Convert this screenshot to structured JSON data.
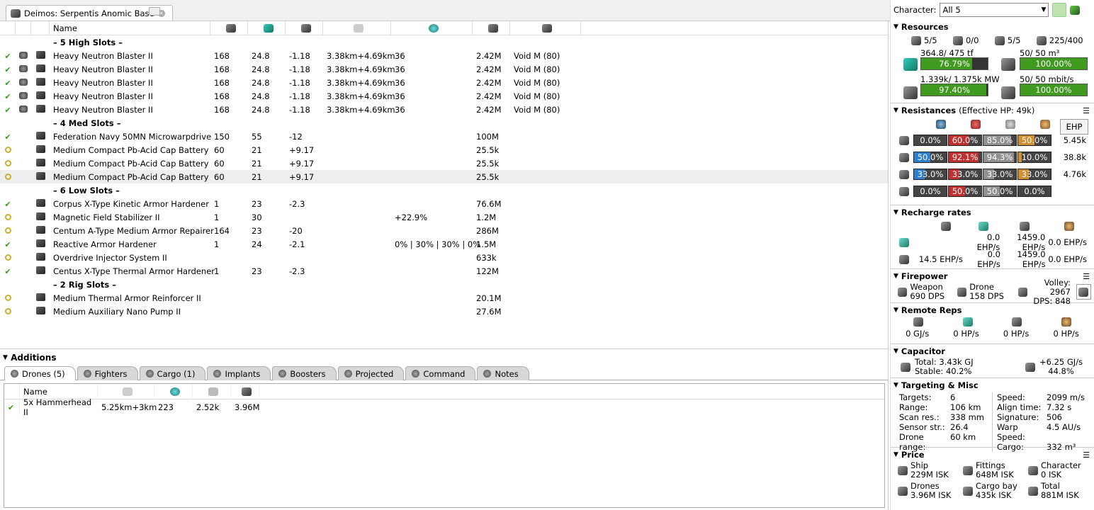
{
  "tab": {
    "title": "Deimos: Serpentis Anomic Base"
  },
  "fitting": {
    "col_name": "Name",
    "slots": [
      {
        "type": "header",
        "label": "– 5 High Slots –"
      },
      {
        "type": "mod",
        "state": "check",
        "name": "Heavy Neutron Blaster II",
        "cpu": "168",
        "pg": "24.8",
        "cap": "-1.18",
        "range": "3.38km+4.69km",
        "opt": "36",
        "price": "2.42M",
        "ammo": "Void M (80)",
        "charge": true
      },
      {
        "type": "mod",
        "state": "check",
        "name": "Heavy Neutron Blaster II",
        "cpu": "168",
        "pg": "24.8",
        "cap": "-1.18",
        "range": "3.38km+4.69km",
        "opt": "36",
        "price": "2.42M",
        "ammo": "Void M (80)",
        "charge": true
      },
      {
        "type": "mod",
        "state": "check",
        "name": "Heavy Neutron Blaster II",
        "cpu": "168",
        "pg": "24.8",
        "cap": "-1.18",
        "range": "3.38km+4.69km",
        "opt": "36",
        "price": "2.42M",
        "ammo": "Void M (80)",
        "charge": true
      },
      {
        "type": "mod",
        "state": "check",
        "name": "Heavy Neutron Blaster II",
        "cpu": "168",
        "pg": "24.8",
        "cap": "-1.18",
        "range": "3.38km+4.69km",
        "opt": "36",
        "price": "2.42M",
        "ammo": "Void M (80)",
        "charge": true
      },
      {
        "type": "mod",
        "state": "check",
        "name": "Heavy Neutron Blaster II",
        "cpu": "168",
        "pg": "24.8",
        "cap": "-1.18",
        "range": "3.38km+4.69km",
        "opt": "36",
        "price": "2.42M",
        "ammo": "Void M (80)",
        "charge": true
      },
      {
        "type": "header",
        "label": "– 4 Med Slots –"
      },
      {
        "type": "mod",
        "state": "check",
        "name": "Federation Navy 50MN Microwarpdrive",
        "cpu": "150",
        "pg": "55",
        "cap": "-12",
        "range": "",
        "opt": "",
        "price": "100M",
        "ammo": ""
      },
      {
        "type": "mod",
        "state": "circle",
        "name": "Medium Compact Pb-Acid Cap Battery",
        "cpu": "60",
        "pg": "21",
        "cap": "+9.17",
        "range": "",
        "opt": "",
        "price": "25.5k",
        "ammo": ""
      },
      {
        "type": "mod",
        "state": "circle",
        "name": "Medium Compact Pb-Acid Cap Battery",
        "cpu": "60",
        "pg": "21",
        "cap": "+9.17",
        "range": "",
        "opt": "",
        "price": "25.5k",
        "ammo": ""
      },
      {
        "type": "mod",
        "state": "circle",
        "name": "Medium Compact Pb-Acid Cap Battery",
        "cpu": "60",
        "pg": "21",
        "cap": "+9.17",
        "range": "",
        "opt": "",
        "price": "25.5k",
        "ammo": "",
        "sel": true
      },
      {
        "type": "header",
        "label": "– 6 Low Slots –"
      },
      {
        "type": "mod",
        "state": "check",
        "name": "Corpus X-Type Kinetic Armor Hardener",
        "cpu": "1",
        "pg": "23",
        "cap": "-2.3",
        "range": "",
        "opt": "",
        "price": "76.6M",
        "ammo": ""
      },
      {
        "type": "mod",
        "state": "circle",
        "name": "Magnetic Field Stabilizer II",
        "cpu": "1",
        "pg": "30",
        "cap": "",
        "range": "",
        "opt": "+22.9%",
        "price": "1.2M",
        "ammo": ""
      },
      {
        "type": "mod",
        "state": "circle",
        "name": "Centum A-Type Medium Armor Repairer",
        "cpu": "164",
        "pg": "23",
        "cap": "-20",
        "range": "",
        "opt": "",
        "price": "286M",
        "ammo": ""
      },
      {
        "type": "mod",
        "state": "check",
        "name": "Reactive Armor Hardener",
        "cpu": "1",
        "pg": "24",
        "cap": "-2.1",
        "range": "",
        "opt": "0% | 30% | 30% | 0%",
        "price": "1.5M",
        "ammo": ""
      },
      {
        "type": "mod",
        "state": "circle",
        "name": "Overdrive Injector System II",
        "cpu": "",
        "pg": "",
        "cap": "",
        "range": "",
        "opt": "",
        "price": "633k",
        "ammo": ""
      },
      {
        "type": "mod",
        "state": "check",
        "name": "Centus X-Type Thermal Armor Hardener",
        "cpu": "1",
        "pg": "23",
        "cap": "-2.3",
        "range": "",
        "opt": "",
        "price": "122M",
        "ammo": ""
      },
      {
        "type": "header",
        "label": "– 2 Rig Slots –"
      },
      {
        "type": "mod",
        "state": "circle",
        "name": "Medium Thermal Armor Reinforcer II",
        "cpu": "",
        "pg": "",
        "cap": "",
        "range": "",
        "opt": "",
        "price": "20.1M",
        "ammo": ""
      },
      {
        "type": "mod",
        "state": "circle",
        "name": "Medium Auxiliary Nano Pump II",
        "cpu": "",
        "pg": "",
        "cap": "",
        "range": "",
        "opt": "",
        "price": "27.6M",
        "ammo": ""
      }
    ]
  },
  "additions": {
    "title": "Additions",
    "tabs": [
      "Drones (5)",
      "Fighters",
      "Cargo (1)",
      "Implants",
      "Boosters",
      "Projected",
      "Command",
      "Notes"
    ],
    "drone_col_name": "Name",
    "drones": [
      {
        "name": "5x Hammerhead II",
        "range": "5.25km+3km",
        "v1": "223",
        "v2": "2.52k",
        "price": "3.96M"
      }
    ]
  },
  "character": {
    "label": "Character:",
    "value": "All 5"
  },
  "resources": {
    "title": "Resources",
    "counts": [
      "5/5",
      "0/0",
      "5/5",
      "225/400"
    ],
    "cpu_text": "364.8/ 475 tf",
    "cpu_pct": "76.79%",
    "cpu_frac": 0.768,
    "pg_text": "1.339k/ 1.375k MW",
    "pg_pct": "97.40%",
    "pg_frac": 0.974,
    "drone_bay_text": "50/ 50 m³",
    "drone_bay_pct": "100.00%",
    "drone_bay_frac": 1,
    "bw_text": "50/ 50 mbit/s",
    "bw_pct": "100.00%",
    "bw_frac": 1
  },
  "resistances": {
    "title": "Resistances",
    "ehp_label": "(Effective HP: 49k)",
    "ehp_button": "EHP",
    "rows": [
      {
        "vals": [
          "0.0%",
          "60.0%",
          "85.0%",
          "50.0%"
        ],
        "fracs": [
          0,
          0.6,
          0.85,
          0.5
        ],
        "hp": "5.45k"
      },
      {
        "vals": [
          "50.0%",
          "92.1%",
          "94.3%",
          "10.0%"
        ],
        "fracs": [
          0.5,
          0.921,
          0.943,
          0.1
        ],
        "hp": "38.8k"
      },
      {
        "vals": [
          "33.0%",
          "33.0%",
          "33.0%",
          "33.0%"
        ],
        "fracs": [
          0.33,
          0.33,
          0.33,
          0.33
        ],
        "hp": "4.76k"
      },
      {
        "vals": [
          "0.0%",
          "50.0%",
          "50.0%",
          "0.0%"
        ],
        "fracs": [
          0,
          0.5,
          0.5,
          0
        ],
        "hp": ""
      }
    ],
    "colors": [
      "#2f7fd0",
      "#c03030",
      "#909090",
      "#d09030"
    ]
  },
  "recharge": {
    "title": "Recharge rates",
    "row1": [
      "0.0 EHP/s",
      "1459.0 EHP/s",
      "0.0 EHP/s"
    ],
    "row2": [
      "14.5 EHP/s",
      "0.0 EHP/s",
      "1459.0 EHP/s",
      "0.0 EHP/s"
    ]
  },
  "firepower": {
    "title": "Firepower",
    "weapon_label": "Weapon",
    "weapon_dps": "690 DPS",
    "drone_label": "Drone",
    "drone_dps": "158 DPS",
    "volley": "Volley: 2967",
    "dps": "DPS: 848"
  },
  "remote": {
    "title": "Remote Reps",
    "vals": [
      "0 GJ/s",
      "0 HP/s",
      "0 HP/s",
      "0 HP/s"
    ]
  },
  "capacitor": {
    "title": "Capacitor",
    "total": "Total: 3.43k GJ",
    "stable": "Stable: 40.2%",
    "delta": "+6.25 GJ/s",
    "pct": "44.8%"
  },
  "targeting": {
    "title": "Targeting & Misc",
    "left": [
      [
        "Targets:",
        "6"
      ],
      [
        "Range:",
        "106 km"
      ],
      [
        "Scan res.:",
        "338 mm"
      ],
      [
        "Sensor str.:",
        "26.4"
      ],
      [
        "Drone range:",
        "60 km"
      ]
    ],
    "right": [
      [
        "Speed:",
        "2099 m/s"
      ],
      [
        "Align time:",
        "7.32 s"
      ],
      [
        "Signature:",
        "506"
      ],
      [
        "Warp Speed:",
        "4.5 AU/s"
      ],
      [
        "Cargo:",
        "332 m³"
      ]
    ]
  },
  "price": {
    "title": "Price",
    "items": [
      [
        "Ship",
        "229M ISK"
      ],
      [
        "Fittings",
        "648M ISK"
      ],
      [
        "Character",
        "0 ISK"
      ],
      [
        "Drones",
        "3.96M ISK"
      ],
      [
        "Cargo bay",
        "435k ISK"
      ],
      [
        "Total",
        "881M ISK"
      ]
    ]
  }
}
